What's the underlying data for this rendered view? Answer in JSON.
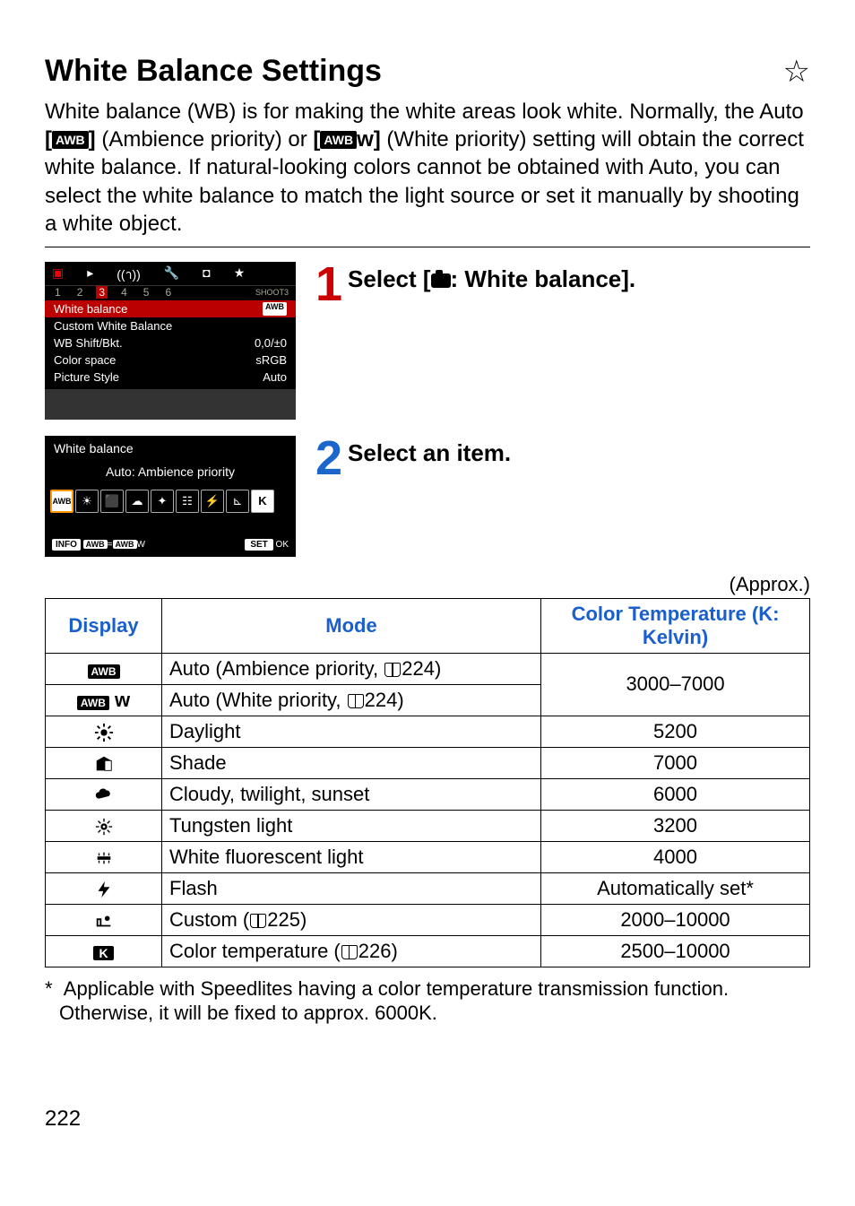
{
  "title": "White Balance Settings",
  "intro_parts": {
    "p1": "White balance (WB) is for making the white areas look white. Normally, the Auto ",
    "b1_open": "[",
    "b1_close": "]",
    "p2": " (Ambience priority) or ",
    "b2_open": "[",
    "b2_label": "w]",
    "p3": " (White priority) setting will obtain the correct white balance. If natural-looking colors cannot be obtained with Auto, you can select the white balance to match the light source or set it manually by shooting a white object."
  },
  "step1": {
    "num": "1",
    "title_pre": "Select [",
    "title_post": ": White balance]."
  },
  "step2": {
    "num": "2",
    "title": "Select an item."
  },
  "screenshot1": {
    "tabs": {
      "nums": [
        "1",
        "2",
        "3",
        "4",
        "5",
        "6"
      ],
      "active_index": 2,
      "shoot_label": "SHOOT3"
    },
    "rows": [
      {
        "label": "White balance",
        "value": "AWB",
        "highlight": true,
        "badge": true
      },
      {
        "label": "Custom White Balance",
        "value": ""
      },
      {
        "label": "WB Shift/Bkt.",
        "value": "0,0/±0"
      },
      {
        "label": "Color space",
        "value": "sRGB"
      },
      {
        "label": "Picture Style",
        "value": "Auto"
      }
    ]
  },
  "screenshot2": {
    "title": "White balance",
    "desc": "Auto: Ambience priority",
    "info_label": "INFO",
    "awb_eq": "AWB = AWB",
    "awb_suffix": "W",
    "set_label": "SET",
    "ok_label": "OK"
  },
  "approx": "(Approx.)",
  "table": {
    "headers": {
      "display": "Display",
      "mode": "Mode",
      "temp": "Color Temperature (K: Kelvin)"
    },
    "rows": [
      {
        "icon": "awb",
        "mode_pre": "Auto (Ambience priority, ",
        "page": "224",
        "mode_post": ")",
        "temp": "3000–7000",
        "rowspan_temp": 2
      },
      {
        "icon": "awbw",
        "mode_pre": "Auto (White priority, ",
        "page": "224",
        "mode_post": ")"
      },
      {
        "icon": "daylight",
        "mode": "Daylight",
        "temp": "5200"
      },
      {
        "icon": "shade",
        "mode": "Shade",
        "temp": "7000"
      },
      {
        "icon": "cloudy",
        "mode": "Cloudy, twilight, sunset",
        "temp": "6000"
      },
      {
        "icon": "tungsten",
        "mode": "Tungsten light",
        "temp": "3200"
      },
      {
        "icon": "fluor",
        "mode": "White fluorescent light",
        "temp": "4000"
      },
      {
        "icon": "flash",
        "mode": "Flash",
        "temp": "Automatically set*"
      },
      {
        "icon": "custom",
        "mode_pre": "Custom (",
        "page": "225",
        "mode_post": ")",
        "temp": "2000–10000"
      },
      {
        "icon": "kelvin",
        "mode_pre": "Color temperature (",
        "page": "226",
        "mode_post": ")",
        "temp": "2500–10000"
      }
    ]
  },
  "footnote": "*  Applicable with Speedlites having a color temperature transmission function. Otherwise, it will be fixed to approx. 6000K.",
  "page_number": "222"
}
